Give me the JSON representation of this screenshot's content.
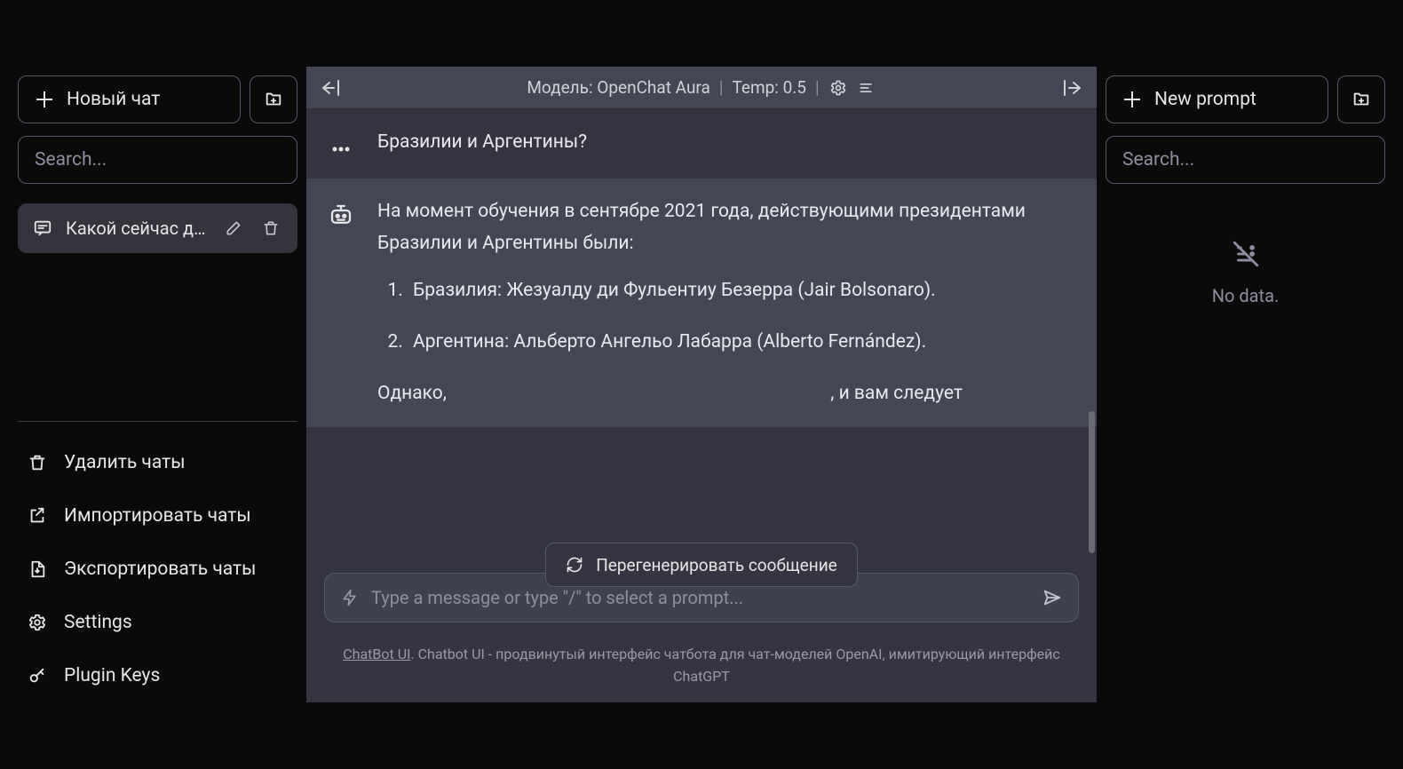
{
  "left_sidebar": {
    "new_chat_label": "Новый чат",
    "search_placeholder": "Search...",
    "chats": [
      {
        "label": "Какой сейчас день, ..."
      }
    ],
    "actions": {
      "delete_chats": "Удалить чаты",
      "import_chats": "Импортировать чаты",
      "export_chats": "Экспортировать чаты",
      "settings": "Settings",
      "plugin_keys": "Plugin Keys"
    }
  },
  "chat": {
    "header": {
      "model_label": "Модель: OpenChat Aura",
      "temp_label": "Temp: 0.5"
    },
    "user_message_tail": "Бразилии и Аргентины?",
    "bot_message": {
      "intro": "На момент обучения в сентябре 2021 года, действующими президентами Бразилии и Аргентины были:",
      "list": [
        "Бразилия: Жезуалду ди Фульентиу Безерра (Jair Bolsonaro).",
        "Аргентина: Альберто Ангельо Лабарра (Alberto Fernández)."
      ],
      "outro_left": "Однако, ",
      "outro_right": ", и вам следует"
    },
    "regenerate_label": "Перегенерировать сообщение",
    "input_placeholder": "Type a message or type \"/\" to select a prompt...",
    "footer": {
      "link_text": "ChatBot UI",
      "rest": ". Chatbot UI - продвинутый интерфейс чатбота для чат-моделей OpenAI, имитирующий интерфейс ChatGPT"
    }
  },
  "right_sidebar": {
    "new_prompt_label": "New prompt",
    "search_placeholder": "Search...",
    "no_data_label": "No data."
  }
}
